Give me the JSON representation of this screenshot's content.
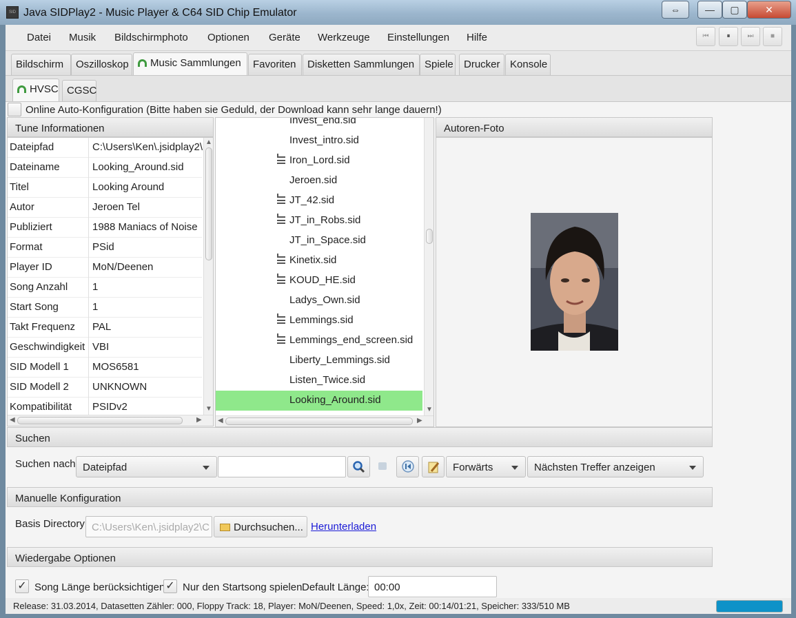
{
  "window": {
    "title": "Java SIDPlay2 - Music Player & C64 SID Chip Emulator",
    "buttons": {
      "restore": "⇔",
      "minimize": "—",
      "maximize": "▢",
      "close": "✕"
    }
  },
  "menu": [
    "Datei",
    "Musik",
    "Bildschirmphoto",
    "Optionen",
    "Geräte",
    "Werkzeuge",
    "Einstellungen",
    "Hilfe"
  ],
  "player_controls": {
    "prev": "⏮",
    "pause": "⏸",
    "next": "⏭",
    "stop": "■"
  },
  "main_tabs": [
    "Bildschirm",
    "Oszilloskop",
    "Music Sammlungen",
    "Favoriten",
    "Disketten Sammlungen",
    "Spiele",
    "Drucker",
    "Konsole"
  ],
  "sub_tabs": [
    "HVSC",
    "CGSC"
  ],
  "online_config": {
    "label": "Online Auto-Konfiguration (Bitte haben sie Geduld, der Download kann sehr lange dauern!)",
    "checked": false
  },
  "tune_info": {
    "title": "Tune Informationen",
    "rows": [
      {
        "key": "Dateipfad",
        "value": "C:\\Users\\Ken\\.jsidplay2\\"
      },
      {
        "key": "Dateiname",
        "value": "Looking_Around.sid"
      },
      {
        "key": "Titel",
        "value": "Looking Around"
      },
      {
        "key": "Autor",
        "value": "Jeroen Tel"
      },
      {
        "key": "Publiziert",
        "value": "1988 Maniacs of Noise"
      },
      {
        "key": "Format",
        "value": "PSid"
      },
      {
        "key": "Player ID",
        "value": "MoN/Deenen"
      },
      {
        "key": "Song Anzahl",
        "value": "1"
      },
      {
        "key": "Start Song",
        "value": "1"
      },
      {
        "key": "Takt Frequenz",
        "value": "PAL"
      },
      {
        "key": "Geschwindigkeit",
        "value": "VBI"
      },
      {
        "key": "SID Modell 1",
        "value": "MOS6581"
      },
      {
        "key": "SID Modell 2",
        "value": "UNKNOWN"
      },
      {
        "key": "Kompatibilität",
        "value": "PSIDv2"
      }
    ]
  },
  "files": [
    {
      "name": "Invest_end.sid",
      "icon": false
    },
    {
      "name": "Invest_intro.sid",
      "icon": false
    },
    {
      "name": "Iron_Lord.sid",
      "icon": true
    },
    {
      "name": "Jeroen.sid",
      "icon": false
    },
    {
      "name": "JT_42.sid",
      "icon": true
    },
    {
      "name": "JT_in_Robs.sid",
      "icon": true
    },
    {
      "name": "JT_in_Space.sid",
      "icon": false
    },
    {
      "name": "Kinetix.sid",
      "icon": true
    },
    {
      "name": "KOUD_HE.sid",
      "icon": true
    },
    {
      "name": "Ladys_Own.sid",
      "icon": false
    },
    {
      "name": "Lemmings.sid",
      "icon": true
    },
    {
      "name": "Lemmings_end_screen.sid",
      "icon": true
    },
    {
      "name": "Liberty_Lemmings.sid",
      "icon": false
    },
    {
      "name": "Listen_Twice.sid",
      "icon": false
    },
    {
      "name": "Looking_Around.sid",
      "icon": false,
      "selected": true
    }
  ],
  "photo_panel": {
    "title": "Autoren-Foto"
  },
  "search": {
    "title": "Suchen",
    "label": "Suchen nach:",
    "field": "Dateipfad",
    "query": "",
    "direction": "Forwärts",
    "mode": "Nächsten Treffer anzeigen"
  },
  "manual_config": {
    "title": "Manuelle Konfiguration",
    "label": "Basis Directory:",
    "path": "C:\\Users\\Ken\\.jsidplay2\\C",
    "browse": "Durchsuchen...",
    "download": "Herunterladen"
  },
  "playback": {
    "title": "Wiedergabe Optionen",
    "song_length_label": "Song Länge berücksichtigen",
    "song_length_checked": true,
    "start_song_label": "Nur den Startsong spielen",
    "start_song_checked": true,
    "default_length_label": "Default Länge:",
    "default_length": "00:00"
  },
  "status": {
    "text": "Release: 31.03.2014, Datasetten Zähler: 000, Floppy Track: 18, Player: MoN/Deenen, Speed: 1,0x, Zeit: 00:14/01:21, Speicher: 333/510 MB"
  },
  "colors": {
    "selected_row": "#8fe88b",
    "progress": "#0e92c8",
    "link": "#1a1ad6",
    "headset_icon": "#3f9a3f"
  }
}
